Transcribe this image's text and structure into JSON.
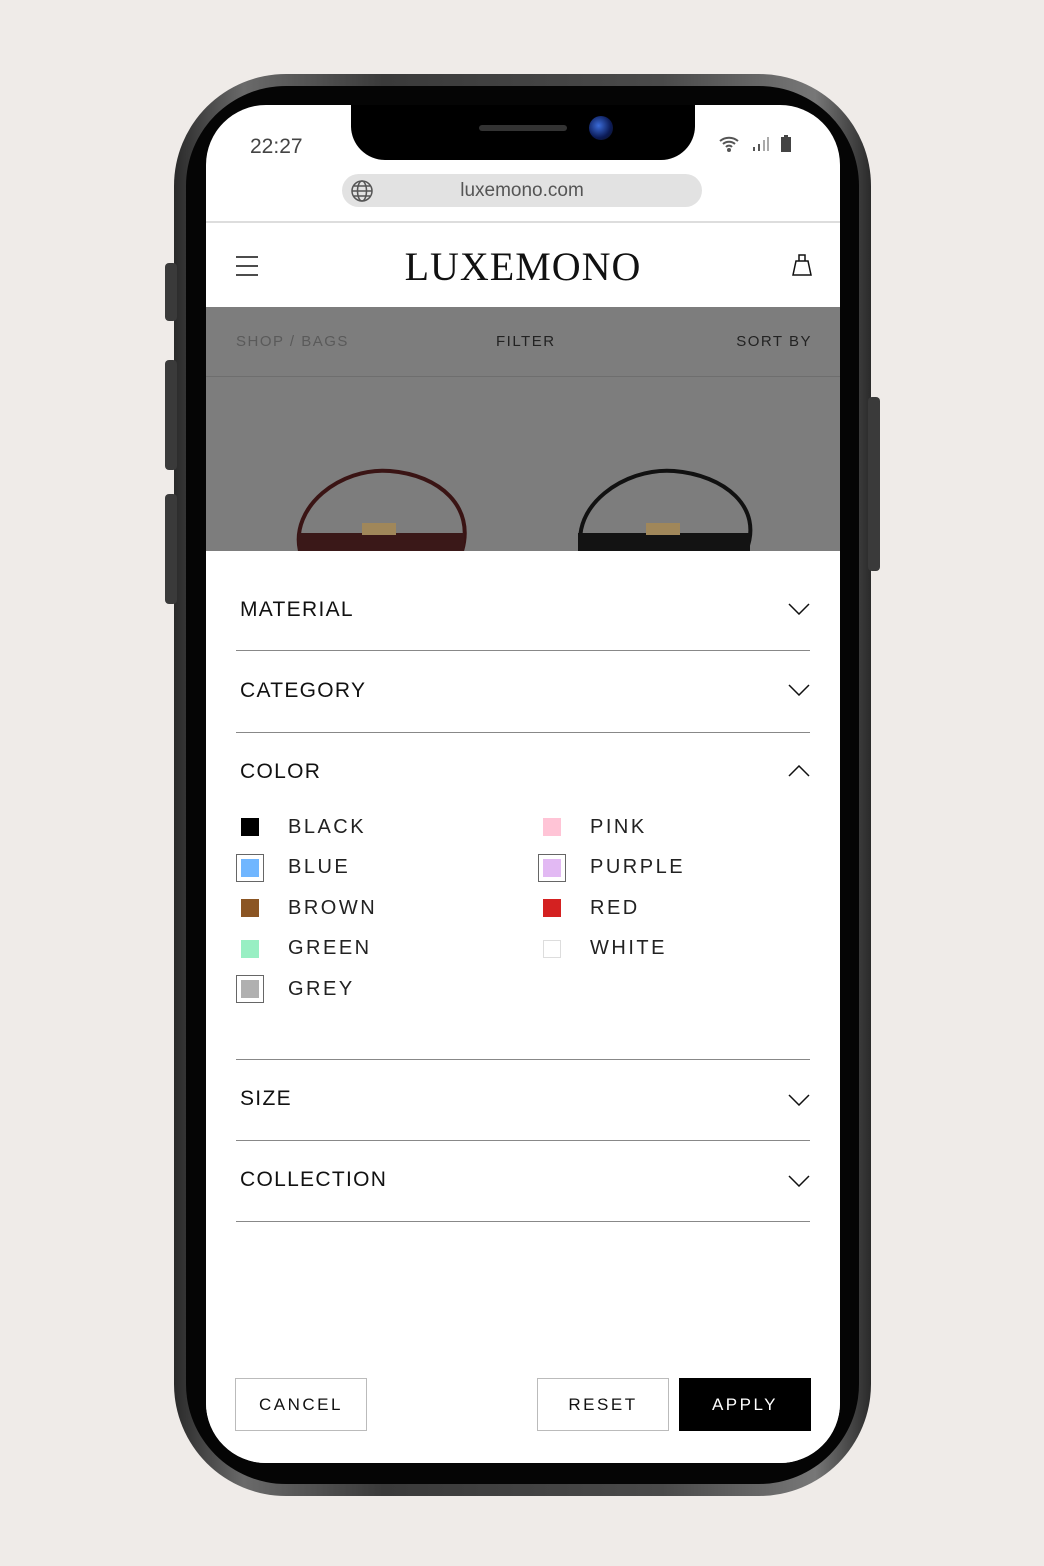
{
  "status_bar": {
    "time": "22:27"
  },
  "browser": {
    "url": "luxemono.com"
  },
  "header": {
    "logo": "LUXEMONO"
  },
  "toolbar": {
    "breadcrumb": "SHOP / BAGS",
    "filter": "FILTER",
    "sort": "SORT BY"
  },
  "filters": {
    "sections": [
      {
        "title": "MATERIAL",
        "expanded": false
      },
      {
        "title": "CATEGORY",
        "expanded": false
      },
      {
        "title": "COLOR",
        "expanded": true
      },
      {
        "title": "SIZE",
        "expanded": false
      },
      {
        "title": "COLLECTION",
        "expanded": false
      }
    ],
    "colors": [
      {
        "label": "BLACK",
        "hex": "#000000",
        "selected": false
      },
      {
        "label": "BLUE",
        "hex": "#70b6ff",
        "selected": true
      },
      {
        "label": "BROWN",
        "hex": "#8b5523",
        "selected": false
      },
      {
        "label": "GREEN",
        "hex": "#98efc3",
        "selected": false
      },
      {
        "label": "GREY",
        "hex": "#b0b0b0",
        "selected": true
      },
      {
        "label": "PINK",
        "hex": "#ffc4d6",
        "selected": false
      },
      {
        "label": "PURPLE",
        "hex": "#e2b9f3",
        "selected": true
      },
      {
        "label": "RED",
        "hex": "#d42121",
        "selected": false
      },
      {
        "label": "WHITE",
        "hex": "#ffffff",
        "selected": false
      }
    ]
  },
  "actions": {
    "cancel": "CANCEL",
    "reset": "RESET",
    "apply": "APPLY"
  }
}
